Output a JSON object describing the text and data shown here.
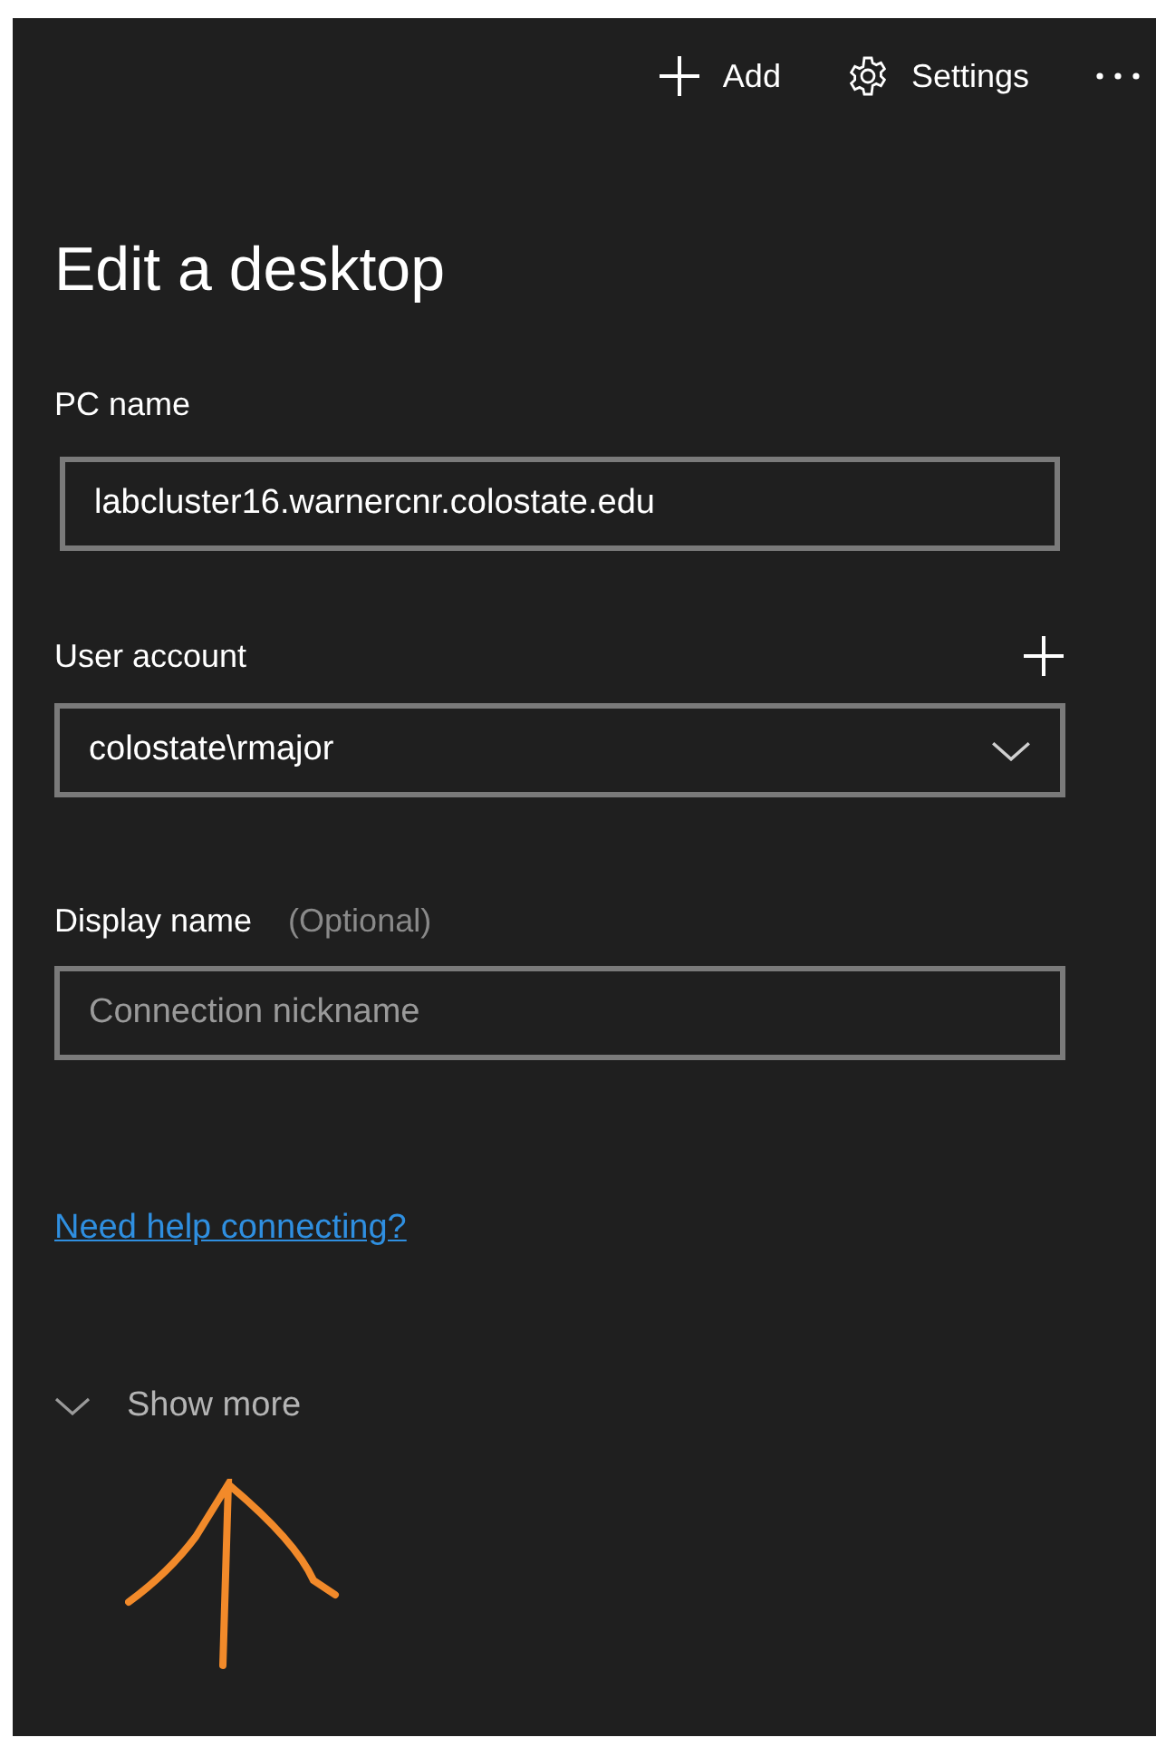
{
  "toolbar": [
    {
      "kind": "add",
      "label": "Add"
    },
    {
      "kind": "settings",
      "label": "Settings"
    },
    {
      "kind": "more"
    }
  ],
  "title": "Edit a desktop",
  "pc_name": {
    "label": "PC name",
    "value": "labcluster16.warnercnr.colostate.edu"
  },
  "user_account": {
    "label": "User account",
    "value": "colostate\\rmajor"
  },
  "display_name": {
    "label": "Display name",
    "hint": "(Optional)",
    "placeholder": "Connection nickname"
  },
  "help_link": "Need help connecting?",
  "show_more": {
    "label": "Show more",
    "expanded": false
  }
}
